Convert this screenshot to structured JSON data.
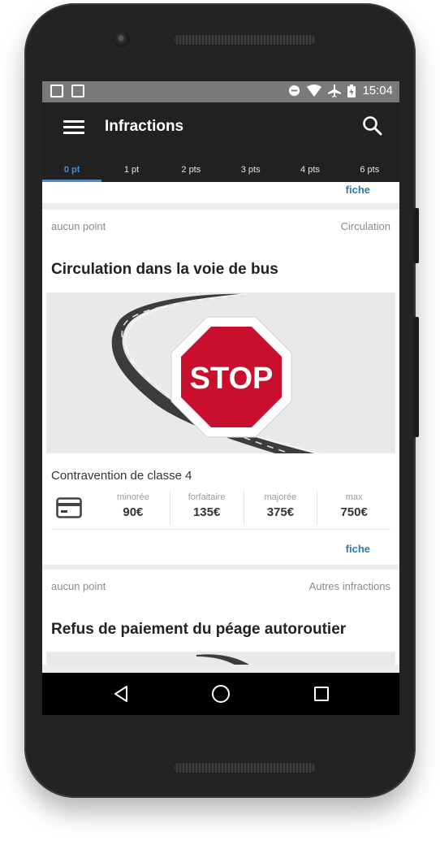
{
  "status_bar": {
    "time": "15:04"
  },
  "toolbar": {
    "title": "Infractions"
  },
  "tabs": [
    {
      "label": "0 pt"
    },
    {
      "label": "1 pt"
    },
    {
      "label": "2 pts"
    },
    {
      "label": "3 pts"
    },
    {
      "label": "4 pts"
    },
    {
      "label": "6 pts"
    }
  ],
  "active_tab_index": 0,
  "colors": {
    "accent": "#3b8fd9",
    "toolbar": "#212121",
    "link": "#2a78b8",
    "stop_sign": "#c8102e"
  },
  "prev_card": {
    "fiche_label": "fiche"
  },
  "cards": [
    {
      "points": "aucun point",
      "category": "Circulation",
      "title": "Circulation dans la voie de bus",
      "image_text": "STOP",
      "classe": "Contravention de classe 4",
      "fines": [
        {
          "label": "minorée",
          "value": "90€"
        },
        {
          "label": "forfaitaire",
          "value": "135€"
        },
        {
          "label": "majorée",
          "value": "375€"
        },
        {
          "label": "max",
          "value": "750€"
        }
      ],
      "fiche_label": "fiche"
    },
    {
      "points": "aucun point",
      "category": "Autres infractions",
      "title": "Refus de paiement du péage autoroutier"
    }
  ],
  "icons": [
    "hamburger-icon",
    "search-icon",
    "credit-card-icon",
    "back-icon",
    "home-icon",
    "recents-icon"
  ]
}
